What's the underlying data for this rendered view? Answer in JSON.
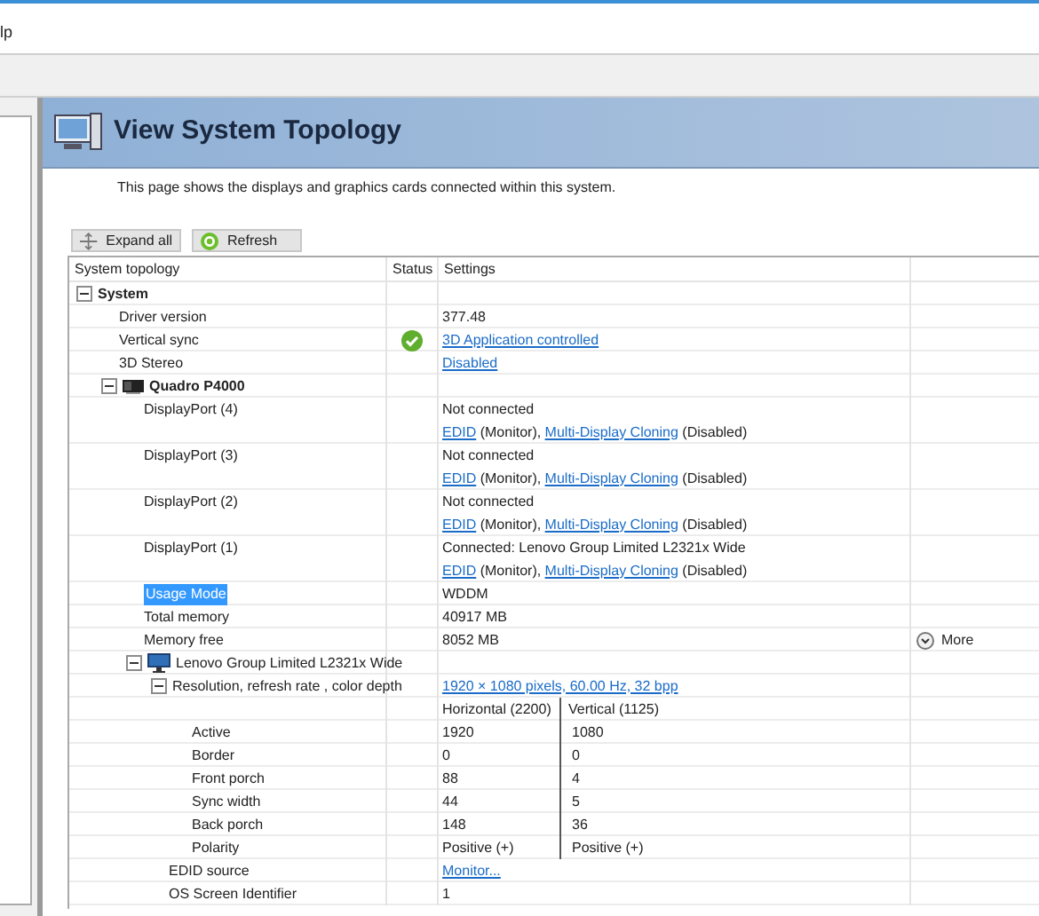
{
  "menu": {
    "items": [
      "lp"
    ]
  },
  "page": {
    "title": "View System Topology",
    "description": "This page shows the displays and graphics cards connected within this system."
  },
  "buttons": [
    {
      "label": "Expand all"
    },
    {
      "label": "Refresh"
    }
  ],
  "table": {
    "columns": [
      "System topology",
      "Status",
      "Settings"
    ],
    "rows": [
      {
        "label": "System",
        "kind": "group",
        "bold": true,
        "expanded": true,
        "selected": false,
        "children": [
          {
            "label": "Driver version",
            "kind": "property",
            "selected": false,
            "settings": [
              [
                {
                  "text": "377.48",
                  "link": false
                }
              ]
            ]
          },
          {
            "label": "Vertical sync",
            "kind": "property",
            "ok": true,
            "selected": false,
            "settings": [
              [
                {
                  "text": "3D Application controlled",
                  "link": true
                }
              ]
            ]
          },
          {
            "label": "3D Stereo",
            "kind": "property",
            "selected": false,
            "settings": [
              [
                {
                  "text": "Disabled",
                  "link": true
                }
              ]
            ]
          },
          {
            "label": "Quadro P4000",
            "kind": "adapter",
            "bold": true,
            "expanded": true,
            "selected": false,
            "children": [
              {
                "label": "DisplayPort (4)",
                "kind": "property",
                "selected": false,
                "settings": [
                  [
                    {
                      "text": "Not connected",
                      "link": false
                    }
                  ],
                  [
                    {
                      "text": "EDID",
                      "link": true
                    },
                    {
                      "text": " (Monitor), ",
                      "link": false
                    },
                    {
                      "text": "Multi-Display Cloning",
                      "link": true
                    },
                    {
                      "text": " (Disabled)",
                      "link": false
                    }
                  ]
                ]
              },
              {
                "label": "DisplayPort (3)",
                "kind": "property",
                "selected": false,
                "settings": [
                  [
                    {
                      "text": "Not connected",
                      "link": false
                    }
                  ],
                  [
                    {
                      "text": "EDID",
                      "link": true
                    },
                    {
                      "text": " (Monitor), ",
                      "link": false
                    },
                    {
                      "text": "Multi-Display Cloning",
                      "link": true
                    },
                    {
                      "text": " (Disabled)",
                      "link": false
                    }
                  ]
                ]
              },
              {
                "label": "DisplayPort (2)",
                "kind": "property",
                "selected": false,
                "settings": [
                  [
                    {
                      "text": "Not connected",
                      "link": false
                    }
                  ],
                  [
                    {
                      "text": "EDID",
                      "link": true
                    },
                    {
                      "text": " (Monitor), ",
                      "link": false
                    },
                    {
                      "text": "Multi-Display Cloning",
                      "link": true
                    },
                    {
                      "text": " (Disabled)",
                      "link": false
                    }
                  ]
                ]
              },
              {
                "label": "DisplayPort (1)",
                "kind": "property",
                "selected": false,
                "settings": [
                  [
                    {
                      "text": "Connected: Lenovo Group Limited L2321x Wide",
                      "link": false
                    }
                  ],
                  [
                    {
                      "text": "EDID",
                      "link": true
                    },
                    {
                      "text": " (Monitor), ",
                      "link": false
                    },
                    {
                      "text": "Multi-Display Cloning",
                      "link": true
                    },
                    {
                      "text": " (Disabled)",
                      "link": false
                    }
                  ]
                ]
              },
              {
                "label": "Usage Mode",
                "kind": "property",
                "selected": true,
                "settings": [
                  [
                    {
                      "text": "WDDM",
                      "link": false
                    }
                  ]
                ]
              },
              {
                "label": "Total memory",
                "kind": "property",
                "selected": false,
                "settings": [
                  [
                    {
                      "text": "40917 MB",
                      "link": false
                    }
                  ]
                ]
              },
              {
                "label": "Memory free",
                "kind": "property",
                "selected": false,
                "more": "More",
                "settings": [
                  [
                    {
                      "text": "8052 MB",
                      "link": false
                    }
                  ]
                ]
              },
              {
                "label": "Lenovo Group Limited L2321x Wide",
                "kind": "display",
                "bold": false,
                "expanded": true,
                "selected": false,
                "children": [
                  {
                    "label": "Resolution, refresh rate , color depth",
                    "kind": "group",
                    "bold": false,
                    "expanded": true,
                    "selected": false,
                    "settings": [
                      [
                        {
                          "text": "1920 × 1080 pixels, 60.00 Hz, 32 bpp",
                          "link": true
                        }
                      ]
                    ],
                    "children": [
                      {
                        "kind": "timing-header",
                        "selected": false,
                        "horizontal": "Horizontal (2200)",
                        "vertical": "Vertical (1125)"
                      },
                      {
                        "label": "Active",
                        "kind": "timing",
                        "selected": false,
                        "horizontal": "1920",
                        "vertical": "1080"
                      },
                      {
                        "label": "Border",
                        "kind": "timing",
                        "selected": false,
                        "horizontal": "0",
                        "vertical": "0"
                      },
                      {
                        "label": "Front porch",
                        "kind": "timing",
                        "selected": false,
                        "horizontal": "88",
                        "vertical": "4"
                      },
                      {
                        "label": "Sync width",
                        "kind": "timing",
                        "selected": false,
                        "horizontal": "44",
                        "vertical": "5"
                      },
                      {
                        "label": "Back porch",
                        "kind": "timing",
                        "selected": false,
                        "horizontal": "148",
                        "vertical": "36"
                      },
                      {
                        "label": "Polarity",
                        "kind": "timing",
                        "selected": false,
                        "horizontal": "Positive (+)",
                        "vertical": "Positive (+)"
                      }
                    ]
                  },
                  {
                    "label": "EDID source",
                    "kind": "property",
                    "selected": false,
                    "settings": [
                      [
                        {
                          "text": "Monitor...",
                          "link": true
                        }
                      ]
                    ]
                  },
                  {
                    "label": "OS Screen Identifier",
                    "kind": "property",
                    "selected": false,
                    "settings": [
                      [
                        {
                          "text": "1",
                          "link": false
                        }
                      ]
                    ]
                  }
                ]
              }
            ]
          }
        ]
      }
    ]
  }
}
